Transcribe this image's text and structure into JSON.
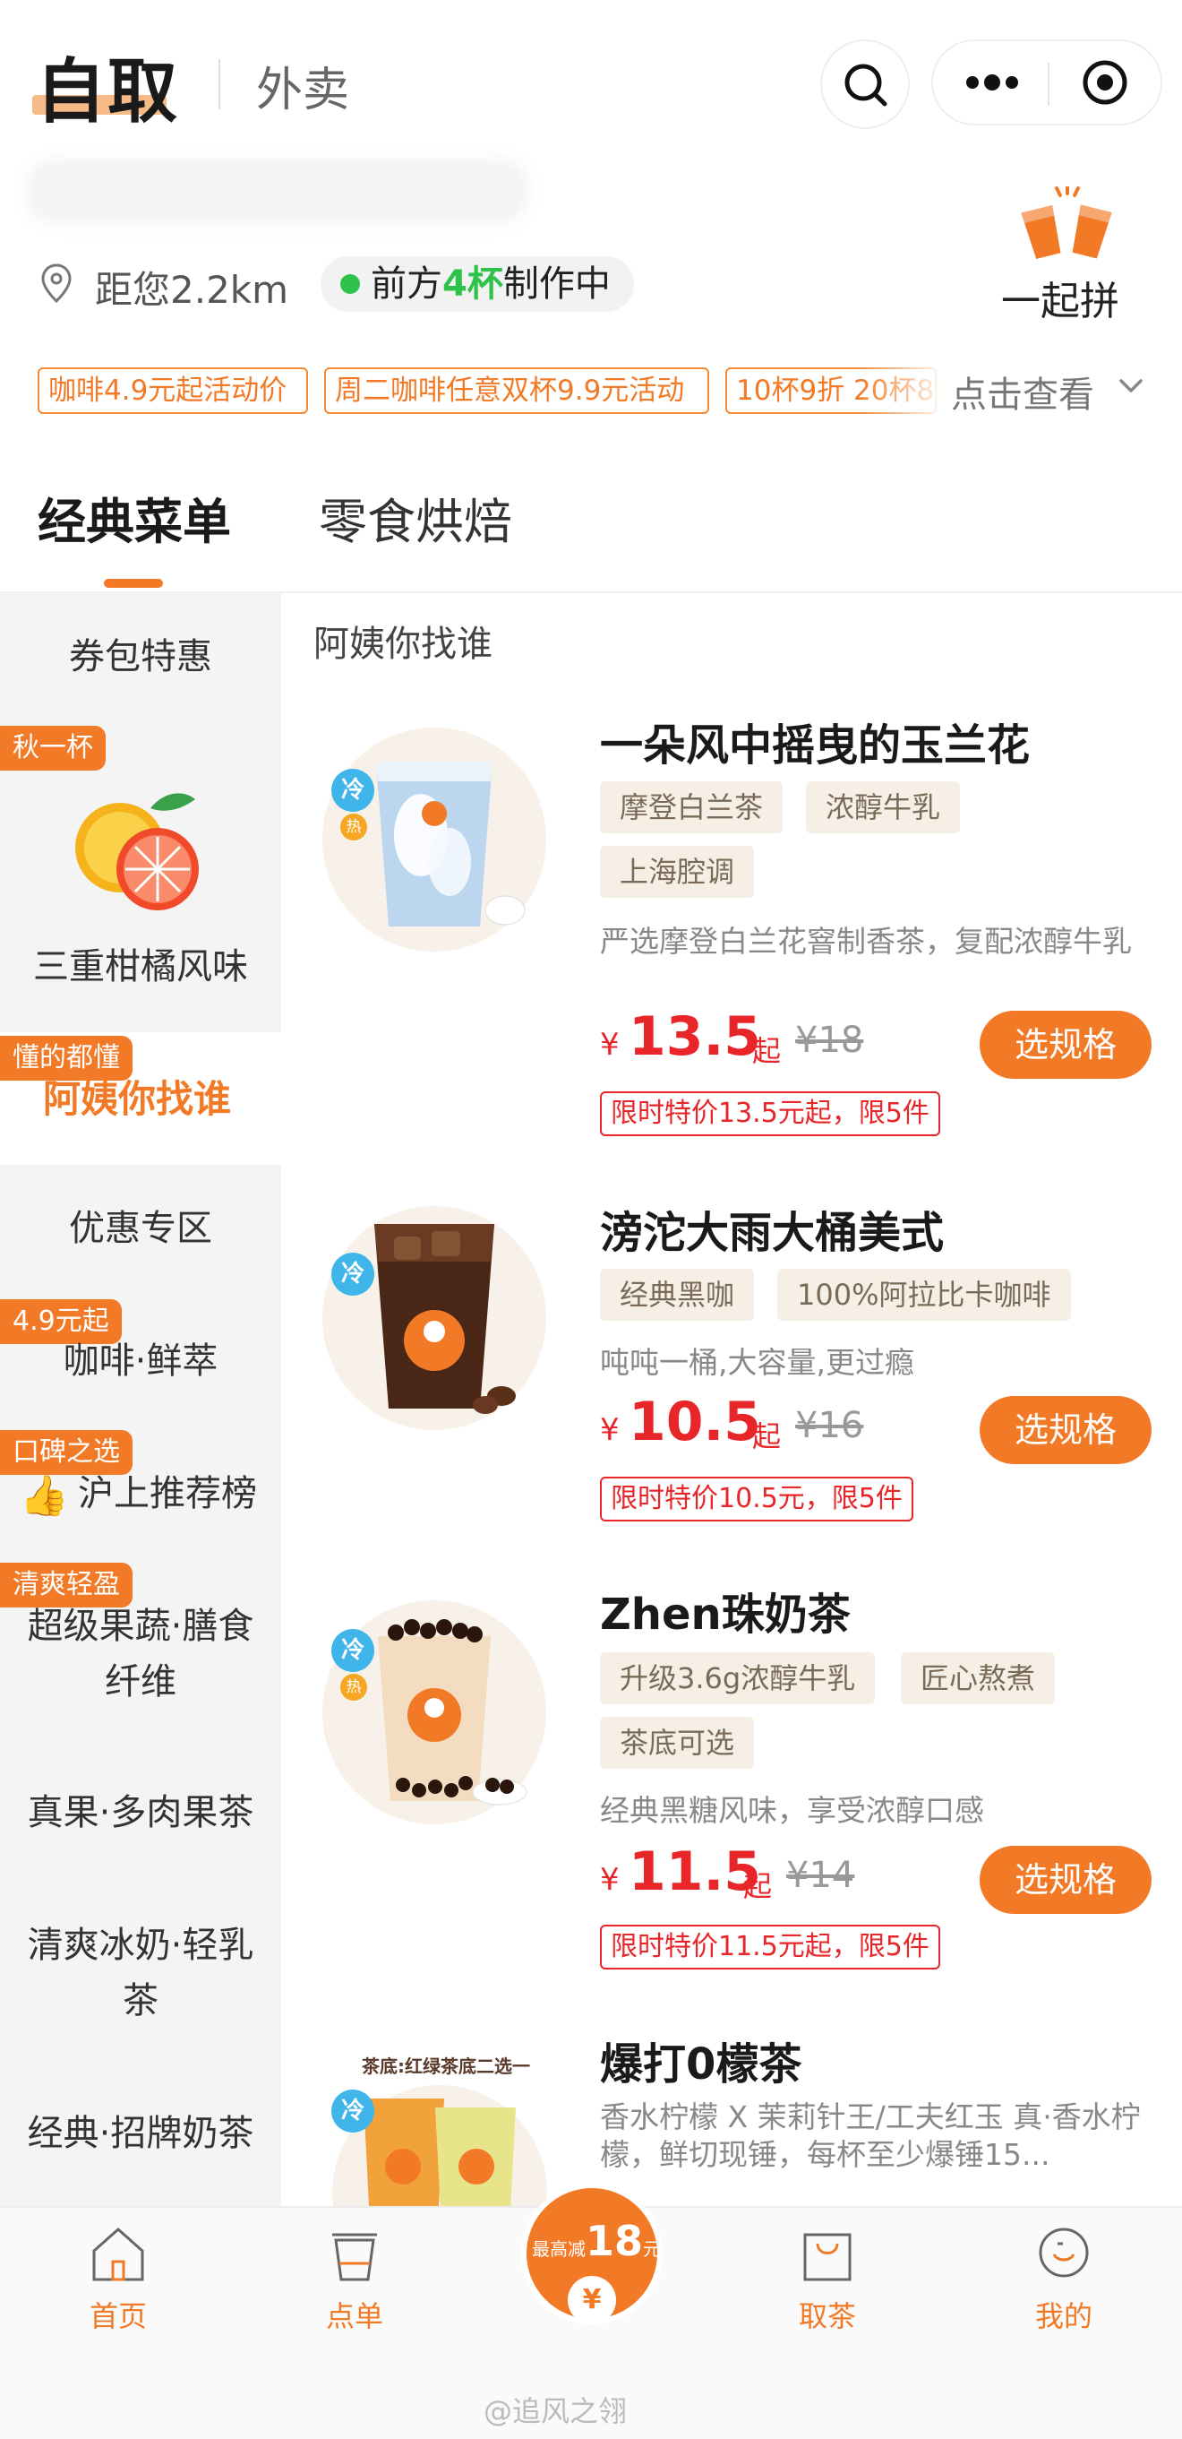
{
  "header": {
    "mode_active": "自取",
    "mode_inactive": "外卖",
    "distance": "距您2.2km",
    "queue_prefix": "前方",
    "queue_count": "4杯",
    "queue_suffix": "制作中",
    "group_order_label": "一起拼"
  },
  "promotions": {
    "items": [
      "咖啡4.9元起活动价",
      "周二咖啡任意双杯9.9元活动",
      "10杯9折 20杯8"
    ],
    "see_more": "点击查看"
  },
  "tabs": [
    {
      "label": "经典菜单",
      "active": true
    },
    {
      "label": "零食烘焙",
      "active": false
    }
  ],
  "sidebar": {
    "items": [
      {
        "label": "券包特惠"
      },
      {
        "label": "三重柑橘风味",
        "badge": "秋一杯"
      },
      {
        "label": "阿姨你找谁",
        "badge": "懂的都懂",
        "active": true
      },
      {
        "label": "优惠专区"
      },
      {
        "label": "咖啡·鲜萃",
        "badge": "4.9元起"
      },
      {
        "label": "沪上推荐榜",
        "badge": "口碑之选"
      },
      {
        "label_line1": "超级果蔬·膳食",
        "label_line2": "纤维",
        "badge": "清爽轻盈"
      },
      {
        "label": "真果·多肉果茶"
      },
      {
        "label_line1": "清爽冰奶·轻乳",
        "label_line2": "茶"
      },
      {
        "label": "经典·招牌奶茶"
      }
    ]
  },
  "main": {
    "section_title": "阿姨你找谁",
    "products": [
      {
        "name": "一朵风中摇曳的玉兰花",
        "tags": [
          "摩登白兰茶",
          "浓醇牛乳",
          "上海腔调"
        ],
        "desc": "严选摩登白兰花窨制香茶，复配浓醇牛乳",
        "currency": "¥",
        "price": "13.5",
        "price_suffix": "起",
        "orig_price": "¥18",
        "limit": "限时特价13.5元起，限5件",
        "button": "选规格",
        "cold": "冷",
        "hot": "热"
      },
      {
        "name": "滂沱大雨大桶美式",
        "tags": [
          "经典黑咖",
          "100%阿拉比卡咖啡"
        ],
        "desc": "吨吨一桶,大容量,更过瘾",
        "currency": "¥",
        "price": "10.5",
        "price_suffix": "起",
        "orig_price": "¥16",
        "limit": "限时特价10.5元，限5件",
        "button": "选规格",
        "cold": "冷"
      },
      {
        "name": "Zhen珠奶茶",
        "tags": [
          "升级3.6g浓醇牛乳",
          "匠心熬煮",
          "茶底可选"
        ],
        "desc": "经典黑糖风味，享受浓醇口感",
        "currency": "¥",
        "price": "11.5",
        "price_suffix": "起",
        "orig_price": "¥14",
        "limit": "限时特价11.5元起，限5件",
        "button": "选规格",
        "cold": "冷",
        "hot": "热"
      },
      {
        "name": "爆打0檬茶",
        "desc": "香水柠檬 X 茉莉针王/工夫红玉 真·香水柠檬，鲜切现锤，每杯至少爆锤15...",
        "image_caption": "茶底:红绿茶底二选一",
        "cold": "冷"
      }
    ]
  },
  "bottom_nav": {
    "items": [
      "首页",
      "点单",
      "取茶",
      "我的"
    ],
    "coupon_prefix": "最高减",
    "coupon_amount": "18",
    "coupon_unit": "元",
    "coupon_symbol": "¥"
  },
  "watermark": "@追风之翎",
  "colors": {
    "accent": "#f27a26",
    "price_red": "#e8262a",
    "status_green": "#2ec24a",
    "cold_blue": "#3fb5ea"
  }
}
